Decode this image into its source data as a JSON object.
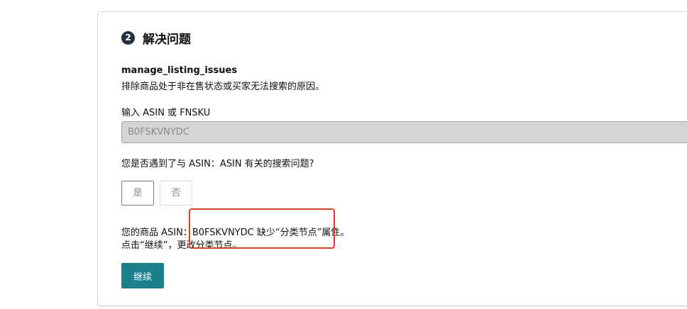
{
  "step": {
    "number": "2",
    "title": "解决问题"
  },
  "section": {
    "key": "manage_listing_issues",
    "description": "排除商品处于非在售状态或买家无法搜索的原因。"
  },
  "asin_field": {
    "label": "输入 ASIN 或 FNSKU",
    "value": "B0FSKVNYDC"
  },
  "question": {
    "text": "您是否遇到了与 ASIN：ASIN 有关的搜索问题?",
    "yes_label": "是",
    "no_label": "否"
  },
  "result": {
    "line1": "您的商品 ASIN：B0FSKVNYDC 缺少“分类节点”属性。",
    "line2": "点击“继续”，更改分类节点。"
  },
  "continue_label": "继续",
  "colors": {
    "primary_button": "#1c7f8c",
    "highlight": "#d9412b",
    "step_badge": "#232f3e"
  }
}
